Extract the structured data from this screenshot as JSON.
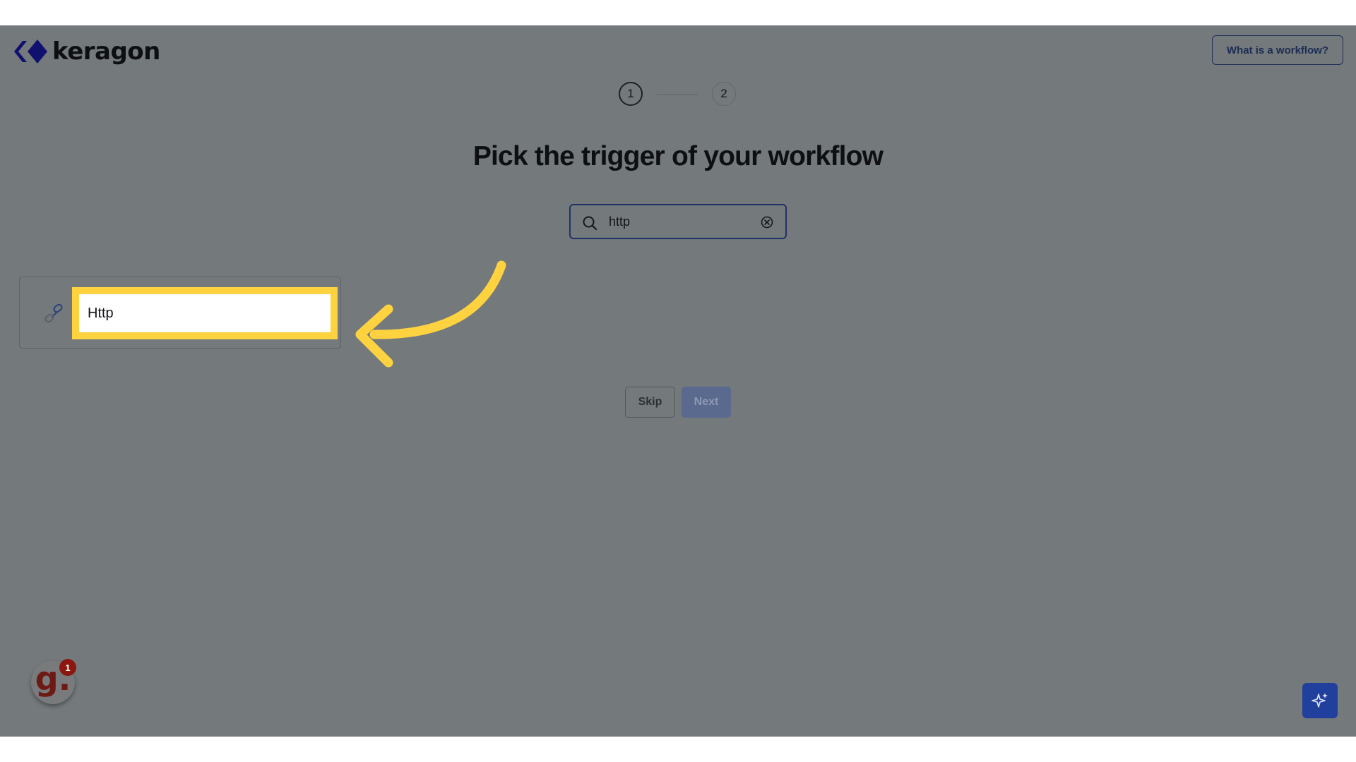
{
  "brand": {
    "name": "keragon"
  },
  "header": {
    "help_button_label": "What is a workflow?"
  },
  "stepper": {
    "steps": [
      "1",
      "2"
    ],
    "current": 1
  },
  "main": {
    "title": "Pick the trigger of your workflow",
    "search": {
      "value": "http",
      "icon": "search-icon",
      "clear_icon": "close-circle-icon"
    },
    "results": [
      {
        "label": "Http",
        "icon": "link-icon"
      }
    ],
    "skip_label": "Skip",
    "next_label": "Next"
  },
  "widgets": {
    "g_badge_letter": "g.",
    "g_badge_count": "1",
    "ai_icon": "sparkles-icon"
  },
  "colors": {
    "overlay": "#74797c",
    "highlight": "#ffd23f",
    "arrow": "#ffd23f",
    "brand": "#1a1aa6",
    "accent": "#213f9c"
  }
}
